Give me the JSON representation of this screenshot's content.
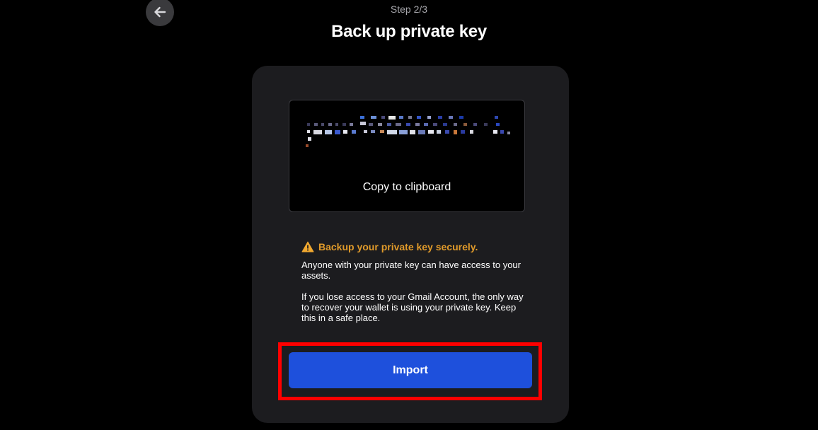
{
  "header": {
    "back_icon": "arrow-left-icon",
    "step": "Step 2/3",
    "title": "Back up private key"
  },
  "key_box": {
    "copy_label": "Copy to clipboard"
  },
  "warning": {
    "icon": "warning-triangle-icon",
    "title": "Backup your private key securely.",
    "paragraph1": "Anyone with your private key can have access to your assets.",
    "paragraph2": "If you lose access to your Gmail Account, the only way to recover your wallet is using your private key. Keep this in a safe place."
  },
  "actions": {
    "import_label": "Import"
  },
  "colors": {
    "background": "#000000",
    "card": "#1c1c1f",
    "accent_button": "#1e50dc",
    "warning": "#e09a2a",
    "highlight": "#ff0000"
  }
}
